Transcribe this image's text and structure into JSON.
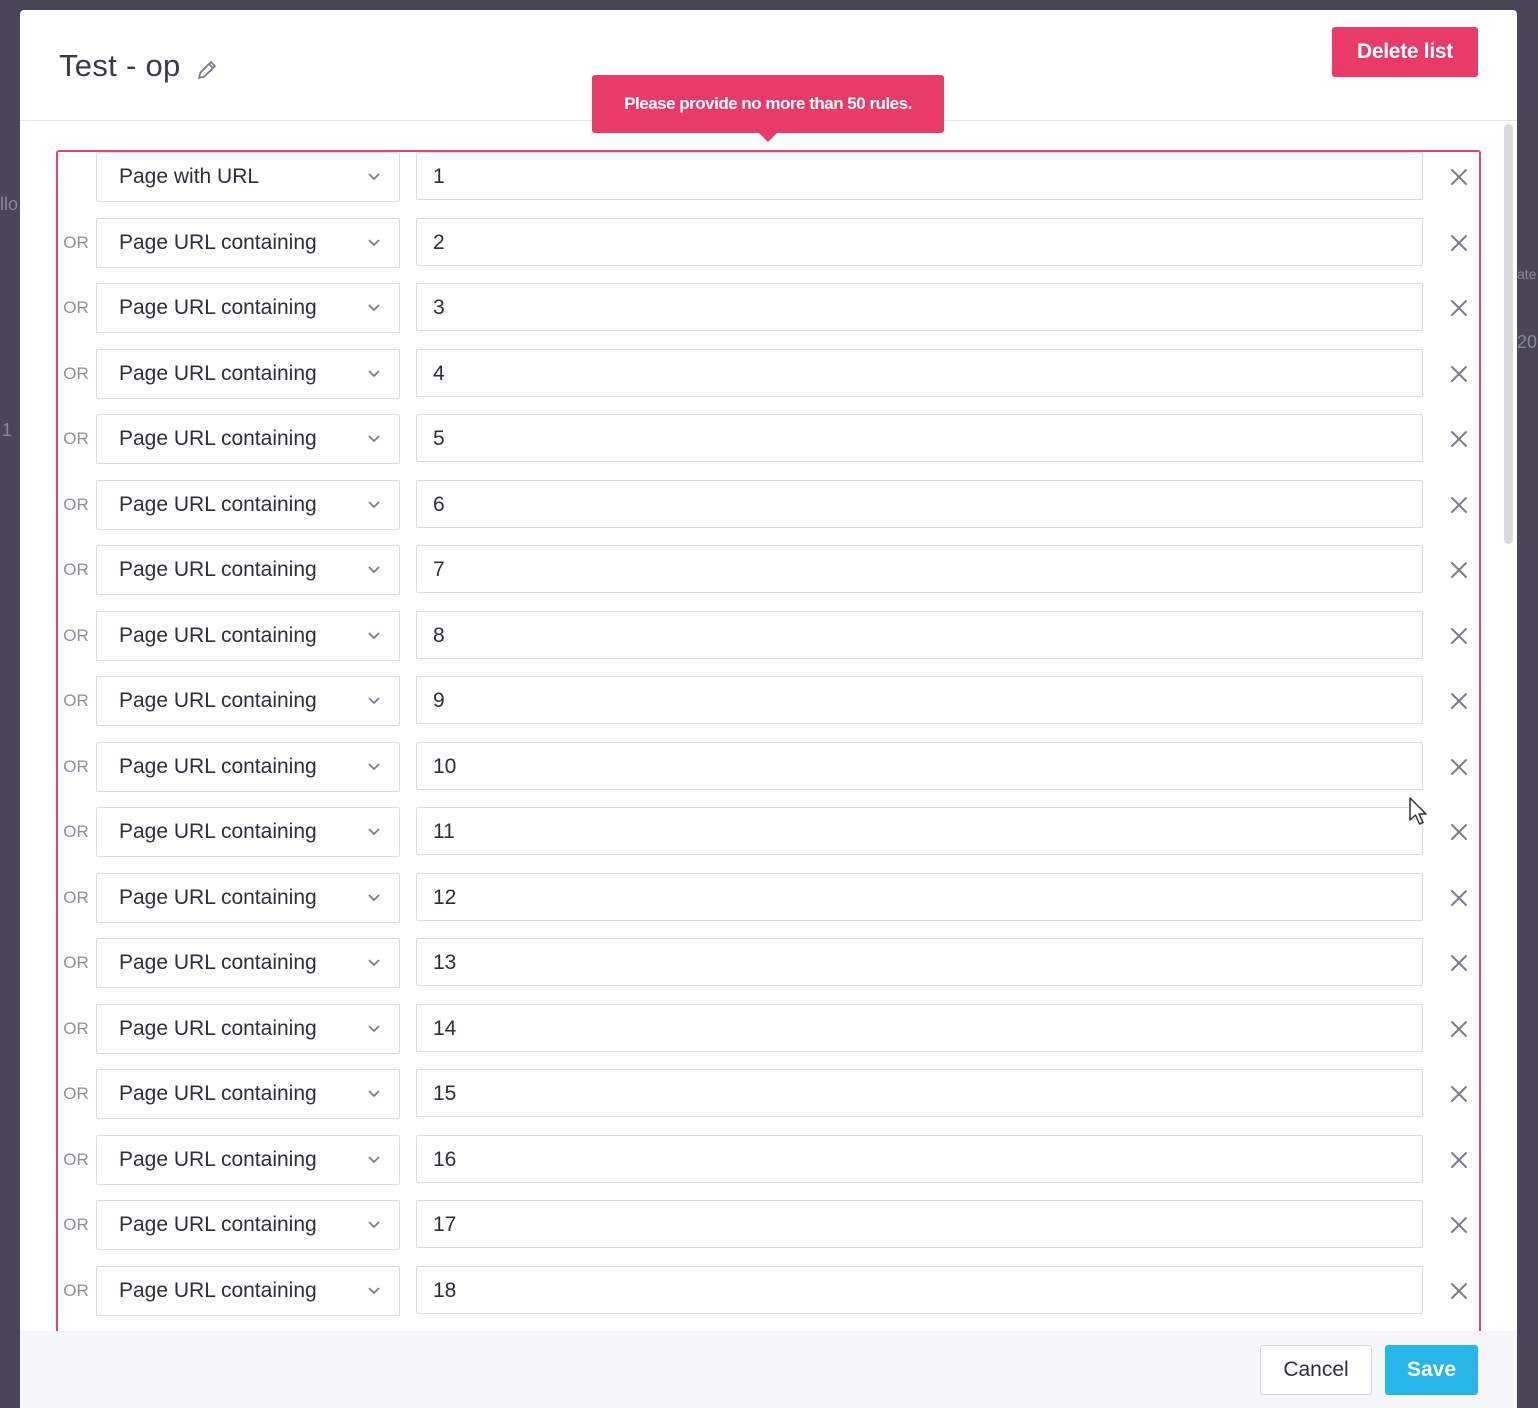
{
  "modal": {
    "title": "Test - op",
    "delete_label": "Delete list",
    "error_tooltip": "Please provide no more than 50 rules.",
    "cancel_label": "Cancel",
    "save_label": "Save"
  },
  "colors": {
    "danger": "#ea3a67",
    "primary": "#27b6e8",
    "backdrop": "#4a4658"
  },
  "icons": {
    "edit": "pencil-icon",
    "chevron": "chevron-down-icon",
    "remove": "close-icon"
  },
  "background_fragments": [
    "llo",
    "1",
    "ate",
    "20"
  ],
  "rules": [
    {
      "connector": "",
      "type": "Page with URL",
      "value": "1"
    },
    {
      "connector": "OR",
      "type": "Page URL containing",
      "value": "2"
    },
    {
      "connector": "OR",
      "type": "Page URL containing",
      "value": "3"
    },
    {
      "connector": "OR",
      "type": "Page URL containing",
      "value": "4"
    },
    {
      "connector": "OR",
      "type": "Page URL containing",
      "value": "5"
    },
    {
      "connector": "OR",
      "type": "Page URL containing",
      "value": "6"
    },
    {
      "connector": "OR",
      "type": "Page URL containing",
      "value": "7"
    },
    {
      "connector": "OR",
      "type": "Page URL containing",
      "value": "8"
    },
    {
      "connector": "OR",
      "type": "Page URL containing",
      "value": "9"
    },
    {
      "connector": "OR",
      "type": "Page URL containing",
      "value": "10"
    },
    {
      "connector": "OR",
      "type": "Page URL containing",
      "value": "11"
    },
    {
      "connector": "OR",
      "type": "Page URL containing",
      "value": "12"
    },
    {
      "connector": "OR",
      "type": "Page URL containing",
      "value": "13"
    },
    {
      "connector": "OR",
      "type": "Page URL containing",
      "value": "14"
    },
    {
      "connector": "OR",
      "type": "Page URL containing",
      "value": "15"
    },
    {
      "connector": "OR",
      "type": "Page URL containing",
      "value": "16"
    },
    {
      "connector": "OR",
      "type": "Page URL containing",
      "value": "17"
    },
    {
      "connector": "OR",
      "type": "Page URL containing",
      "value": "18"
    }
  ]
}
